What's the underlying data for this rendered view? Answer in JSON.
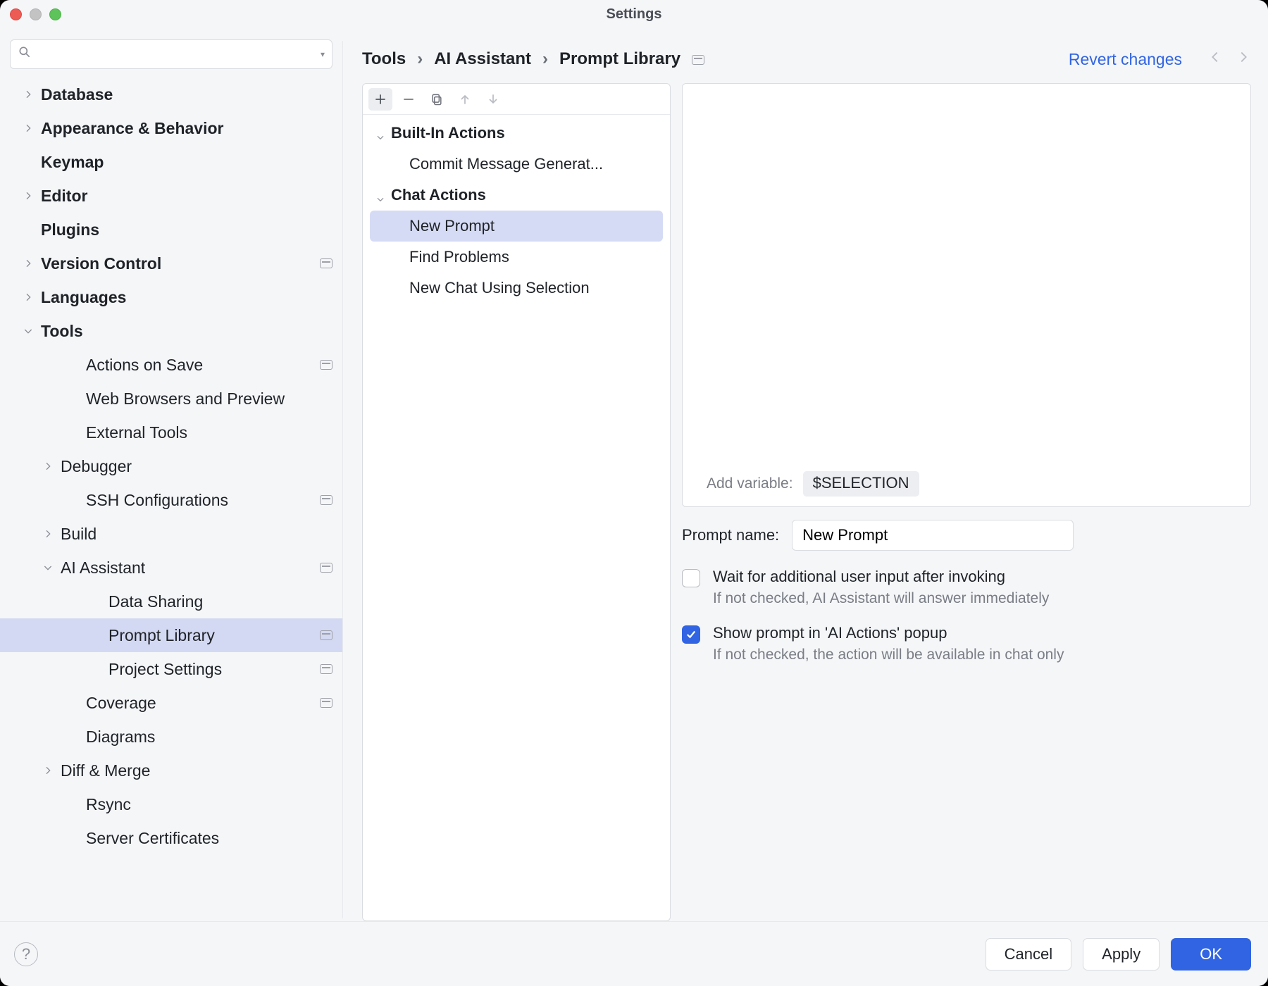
{
  "window": {
    "title": "Settings"
  },
  "header": {
    "breadcrumbs": [
      "Tools",
      "AI Assistant",
      "Prompt Library"
    ],
    "revert": "Revert changes"
  },
  "sidebar": {
    "search_placeholder": "",
    "items": [
      {
        "label": "Database",
        "depth": 0,
        "bold": true,
        "chevron": "right"
      },
      {
        "label": "Appearance & Behavior",
        "depth": 0,
        "bold": true,
        "chevron": "right"
      },
      {
        "label": "Keymap",
        "depth": 0,
        "bold": true,
        "chevron": "none"
      },
      {
        "label": "Editor",
        "depth": 0,
        "bold": true,
        "chevron": "right"
      },
      {
        "label": "Plugins",
        "depth": 0,
        "bold": true,
        "chevron": "none"
      },
      {
        "label": "Version Control",
        "depth": 0,
        "bold": true,
        "chevron": "right",
        "project_badge": true
      },
      {
        "label": "Languages",
        "depth": 0,
        "bold": true,
        "chevron": "right"
      },
      {
        "label": "Tools",
        "depth": 0,
        "bold": true,
        "chevron": "down"
      },
      {
        "label": "Actions on Save",
        "depth": 1,
        "bold": false,
        "chevron": "none",
        "project_badge": true
      },
      {
        "label": "Web Browsers and Preview",
        "depth": 1,
        "bold": false,
        "chevron": "none"
      },
      {
        "label": "External Tools",
        "depth": 1,
        "bold": false,
        "chevron": "none"
      },
      {
        "label": "Debugger",
        "depth": 1,
        "bold": false,
        "chevron": "right"
      },
      {
        "label": "SSH Configurations",
        "depth": 1,
        "bold": false,
        "chevron": "none",
        "project_badge": true
      },
      {
        "label": "Build",
        "depth": 1,
        "bold": false,
        "chevron": "right"
      },
      {
        "label": "AI Assistant",
        "depth": 1,
        "bold": false,
        "chevron": "down",
        "project_badge": true
      },
      {
        "label": "Data Sharing",
        "depth": 2,
        "bold": false,
        "chevron": "none"
      },
      {
        "label": "Prompt Library",
        "depth": 2,
        "bold": false,
        "chevron": "none",
        "project_badge": true,
        "selected": true
      },
      {
        "label": "Project Settings",
        "depth": 2,
        "bold": false,
        "chevron": "none",
        "project_badge": true
      },
      {
        "label": "Coverage",
        "depth": 1,
        "bold": false,
        "chevron": "none",
        "project_badge": true
      },
      {
        "label": "Diagrams",
        "depth": 1,
        "bold": false,
        "chevron": "none"
      },
      {
        "label": "Diff & Merge",
        "depth": 1,
        "bold": false,
        "chevron": "right"
      },
      {
        "label": "Rsync",
        "depth": 1,
        "bold": false,
        "chevron": "none"
      },
      {
        "label": "Server Certificates",
        "depth": 1,
        "bold": false,
        "chevron": "none"
      }
    ]
  },
  "prompt_list": {
    "groups": [
      {
        "name": "Built-In Actions",
        "items": [
          "Commit Message Generat..."
        ]
      },
      {
        "name": "Chat Actions",
        "items": [
          "New Prompt",
          "Find Problems",
          "New Chat Using Selection"
        ]
      }
    ],
    "selected": "New Prompt"
  },
  "editor": {
    "add_variable_label": "Add variable:",
    "variable_chip": "$SELECTION",
    "prompt_name_label": "Prompt name:",
    "prompt_name_value": "New Prompt",
    "check_wait_label": "Wait for additional user input after invoking",
    "check_wait_hint": "If not checked, AI Assistant will answer immediately",
    "check_wait_checked": false,
    "check_show_label": "Show prompt in 'AI Actions' popup",
    "check_show_hint": "If not checked, the action will be available in chat only",
    "check_show_checked": true
  },
  "buttons": {
    "cancel": "Cancel",
    "apply": "Apply",
    "ok": "OK",
    "help": "?"
  }
}
